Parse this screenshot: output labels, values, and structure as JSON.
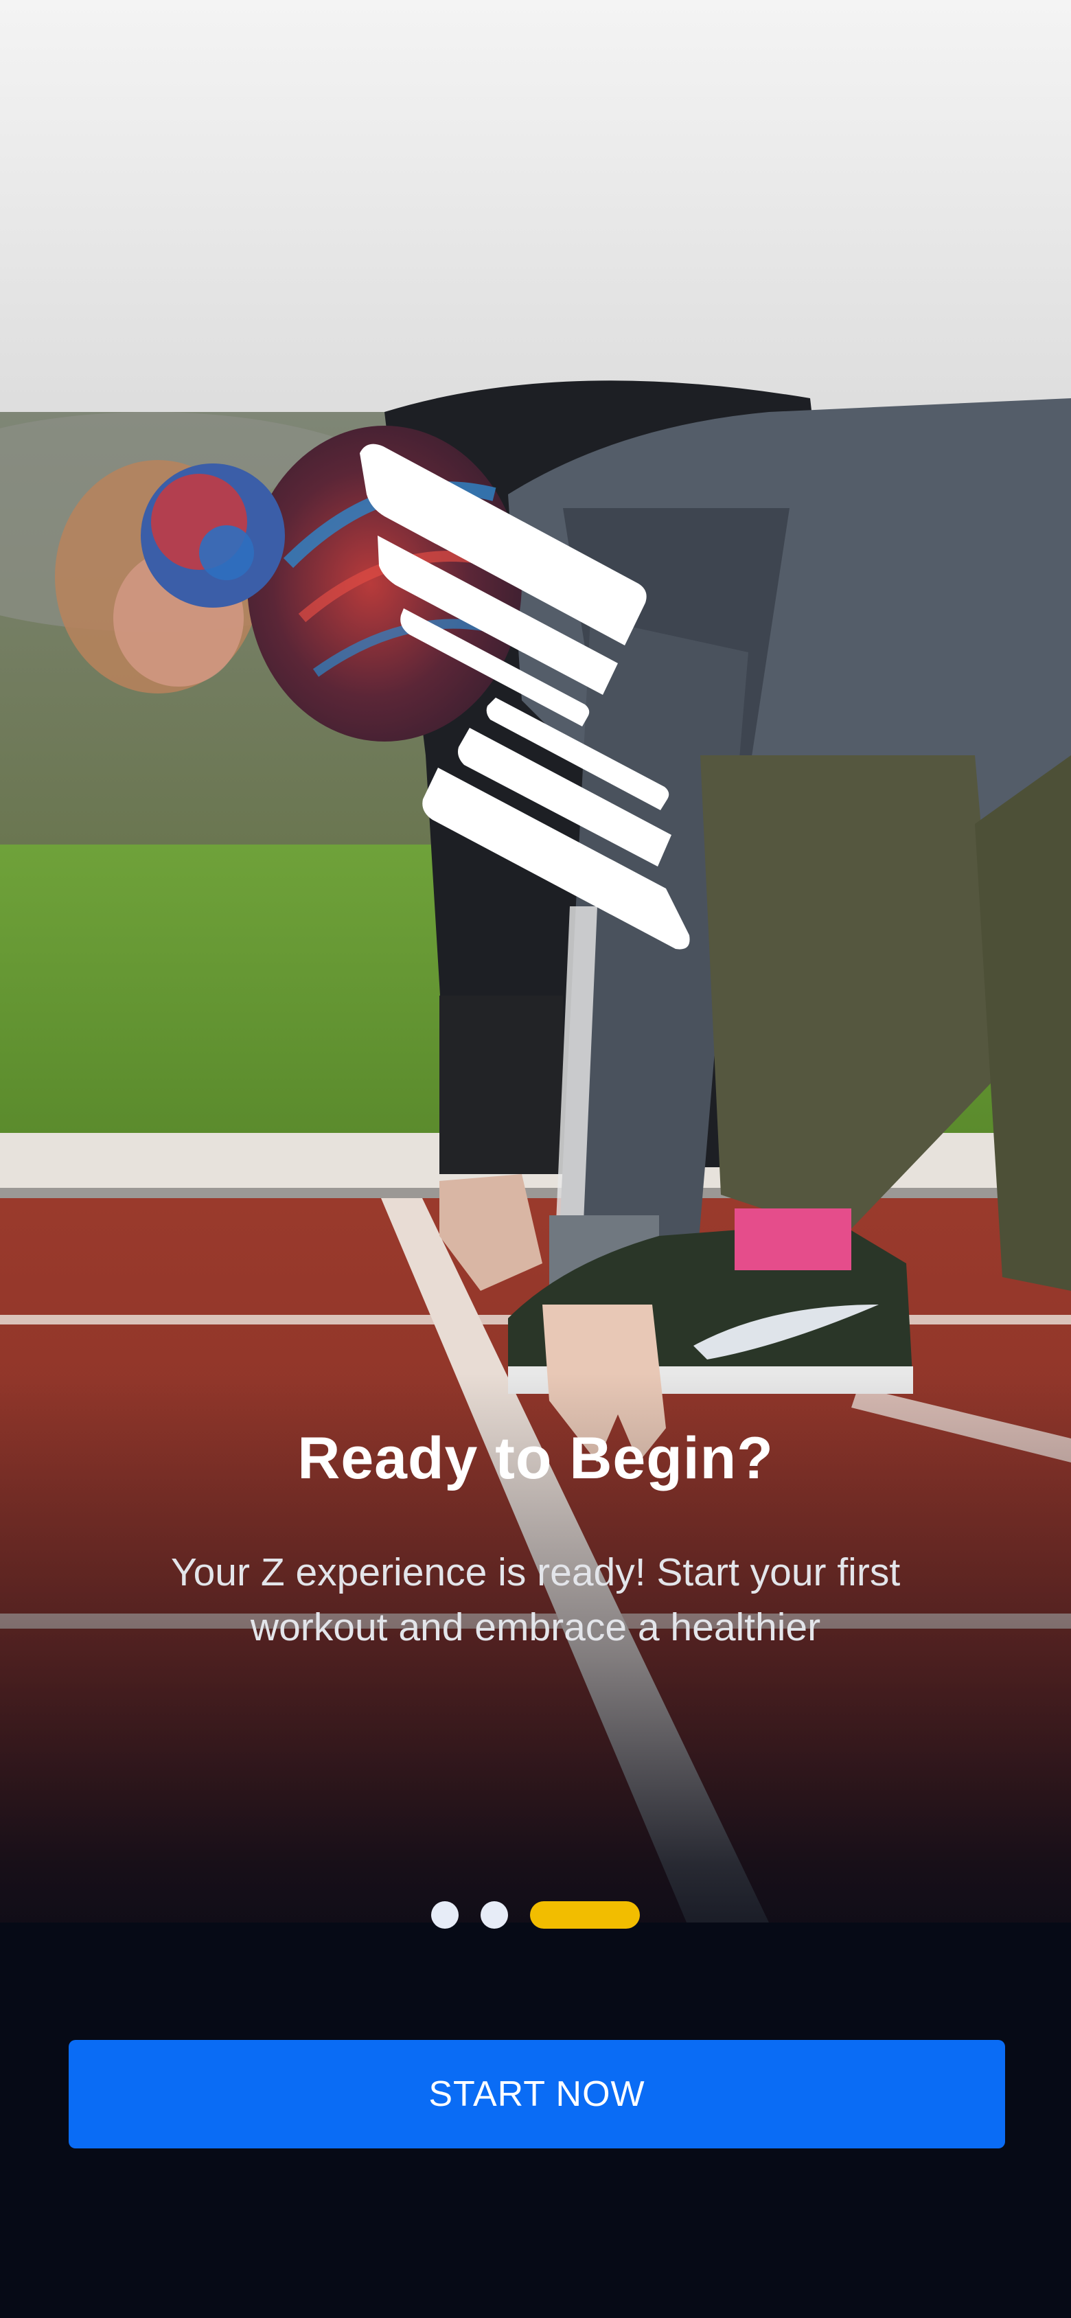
{
  "onboarding": {
    "title": "Ready to Begin?",
    "description": "Your Z experience is ready! Start your first workout and embrace a healthier",
    "background_image": "athlete-on-running-track-start-position",
    "logo_icon": "z-stripes-logo-icon"
  },
  "pager": {
    "total_pages": 3,
    "current_page": 3
  },
  "cta": {
    "label": "START NOW"
  },
  "colors": {
    "background": "#060a16",
    "accent_button": "#0a6cf5",
    "active_indicator": "#f2bd00",
    "inactive_indicator": "#e7ecf7",
    "text_primary": "#ffffff"
  }
}
